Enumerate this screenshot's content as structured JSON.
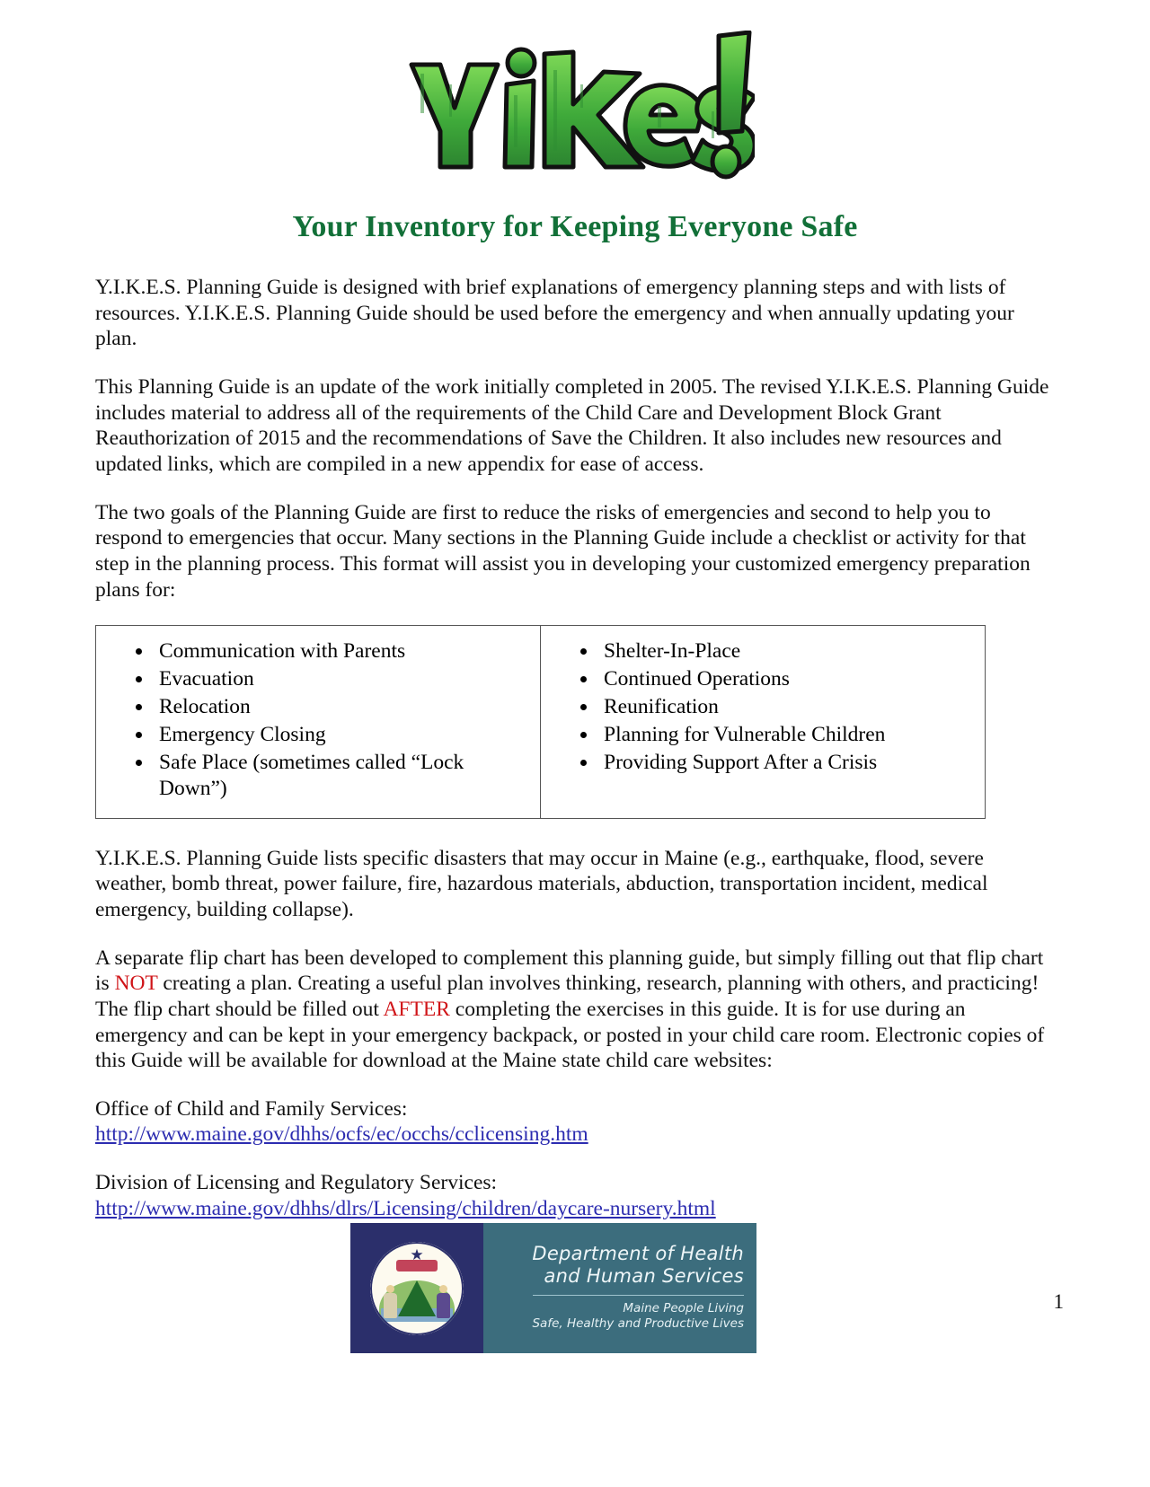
{
  "document": {
    "logo_alt": "YIKES!",
    "logo_text": "Yikes!",
    "title": "Your Inventory for Keeping Everyone Safe",
    "title_color": "#127038",
    "accent_red": "#d01418",
    "link_color": "#2c2cb0",
    "page_number": "1"
  },
  "paragraphs": {
    "intro": "Y.I.K.E.S. Planning Guide is designed with brief explanations of emergency planning steps and with lists of resources.  Y.I.K.E.S. Planning Guide should be used before the emergency and when annually updating your plan.",
    "update": "This Planning Guide is an update of the work initially completed in 2005. The revised Y.I.K.E.S. Planning Guide includes material to address all of the requirements of the Child Care and Development Block Grant Reauthorization of 2015 and the recommendations of Save the Children. It also includes new resources and updated links, which are compiled in a new appendix for ease of access.",
    "goals": "The two goals of the Planning Guide are first to reduce the risks of emergencies and second to help you to respond to emergencies that occur. Many sections in the Planning Guide include a checklist or activity for that step in the planning process. This format will assist you in developing your customized emergency preparation plans for:",
    "disasters": "Y.I.K.E.S. Planning Guide lists specific disasters that may occur in Maine (e.g., earthquake, flood, severe weather, bomb threat, power failure, fire, hazardous materials, abduction, transportation incident, medical emergency, building collapse).",
    "flipchart_1": "A separate flip chart has been developed to complement this planning guide, but simply filling out that flip chart is ",
    "flipchart_not": "NOT",
    "flipchart_2": " creating a plan. Creating a useful plan involves thinking, research, planning with others, and practicing! The flip chart should be filled out ",
    "flipchart_after": "AFTER",
    "flipchart_3": " completing the exercises in this guide. It is for use during an emergency and can be kept in your emergency backpack, or posted in your child care room. Electronic copies of this Guide will be available for download at the Maine state child care websites:"
  },
  "plans_table": {
    "left_column": [
      "Communication with Parents",
      "Evacuation",
      "Relocation",
      "Emergency Closing",
      "Safe Place (sometimes called “Lock Down”)"
    ],
    "right_column": [
      "Shelter-In-Place",
      "Continued Operations",
      "Reunification",
      "Planning for Vulnerable Children",
      "Providing Support After a Crisis"
    ]
  },
  "links": [
    {
      "label": "Office of Child and Family Services:",
      "url": "http://www.maine.gov/dhhs/ocfs/ec/occhs/cclicensing.htm"
    },
    {
      "label": "Division of Licensing and Regulatory Services:",
      "url": "http://www.maine.gov/dhhs/dlrs/Licensing/children/daycare-nursery.html"
    }
  ],
  "dhhs_logo": {
    "name_line_1": "Department of Health",
    "name_line_2": "and Human Services",
    "tagline_line_1": "Maine People Living",
    "tagline_line_2": "Safe, Healthy and Productive Lives",
    "seal_name": "maine-state-seal",
    "navy": "#2b2f6b",
    "teal": "#3c6d7d"
  }
}
